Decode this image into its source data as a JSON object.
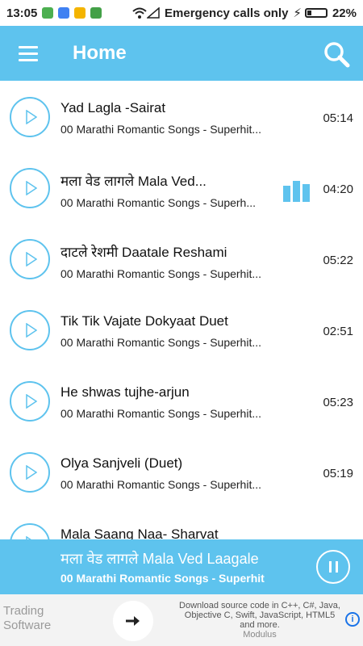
{
  "status_bar": {
    "time": "13:05",
    "carrier_text": "Emergency calls only",
    "battery": "22%",
    "colors": {
      "app1": "#4caf50",
      "app2": "#3f81f2",
      "app3": "#f4b400",
      "app4": "#43a047"
    }
  },
  "app_bar": {
    "title": "Home",
    "color": "#5ec3ee"
  },
  "songs": [
    {
      "title": "Yad Lagla -Sairat",
      "album": "00 Marathi Romantic Songs - Superhit...",
      "duration": "05:14"
    },
    {
      "title": "मला वेड लागले Mala Ved...",
      "album": "00 Marathi Romantic Songs - Superh...",
      "duration": "04:20",
      "playing": true
    },
    {
      "title": "दाटले रेशमी Daatale Reshami",
      "album": "00 Marathi Romantic Songs - Superhit...",
      "duration": "05:22"
    },
    {
      "title": "Tik Tik Vajate Dokyaat Duet",
      "album": "00 Marathi Romantic Songs - Superhit...",
      "duration": "02:51"
    },
    {
      "title": "He shwas tujhe-arjun",
      "album": "00 Marathi Romantic Songs - Superhit...",
      "duration": "05:23"
    },
    {
      "title": " Olya Sanjveli (Duet)",
      "album": "00 Marathi Romantic Songs - Superhit...",
      "duration": "05:19"
    },
    {
      "title": "Mala Saang Naa- Sharvat",
      "album": "",
      "duration": ""
    }
  ],
  "now_playing": {
    "title": "मला वेड लागले Mala Ved Laagale",
    "album": "00 Marathi Romantic Songs - Superhit"
  },
  "ad": {
    "left_line1": "Trading",
    "left_line2": "Software",
    "text": "Download source code in C++, C#, Java, Objective C, Swift, JavaScript, HTML5 and more.",
    "source": "Modulus"
  }
}
